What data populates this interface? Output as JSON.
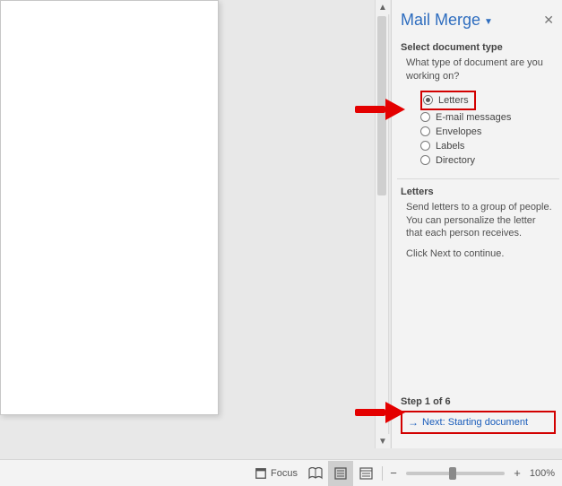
{
  "pane": {
    "title": "Mail Merge",
    "section1": {
      "title": "Select document type",
      "prompt": "What type of document are you working on?",
      "options": [
        {
          "label": "Letters",
          "selected": true
        },
        {
          "label": "E-mail messages",
          "selected": false
        },
        {
          "label": "Envelopes",
          "selected": false
        },
        {
          "label": "Labels",
          "selected": false
        },
        {
          "label": "Directory",
          "selected": false
        }
      ]
    },
    "section2": {
      "title": "Letters",
      "body": "Send letters to a group of people. You can personalize the letter that each person receives.",
      "continue": "Click Next to continue."
    },
    "step": {
      "label": "Step 1 of 6",
      "next_link": "Next: Starting document"
    }
  },
  "statusbar": {
    "focus": "Focus",
    "zoom": "100%"
  }
}
